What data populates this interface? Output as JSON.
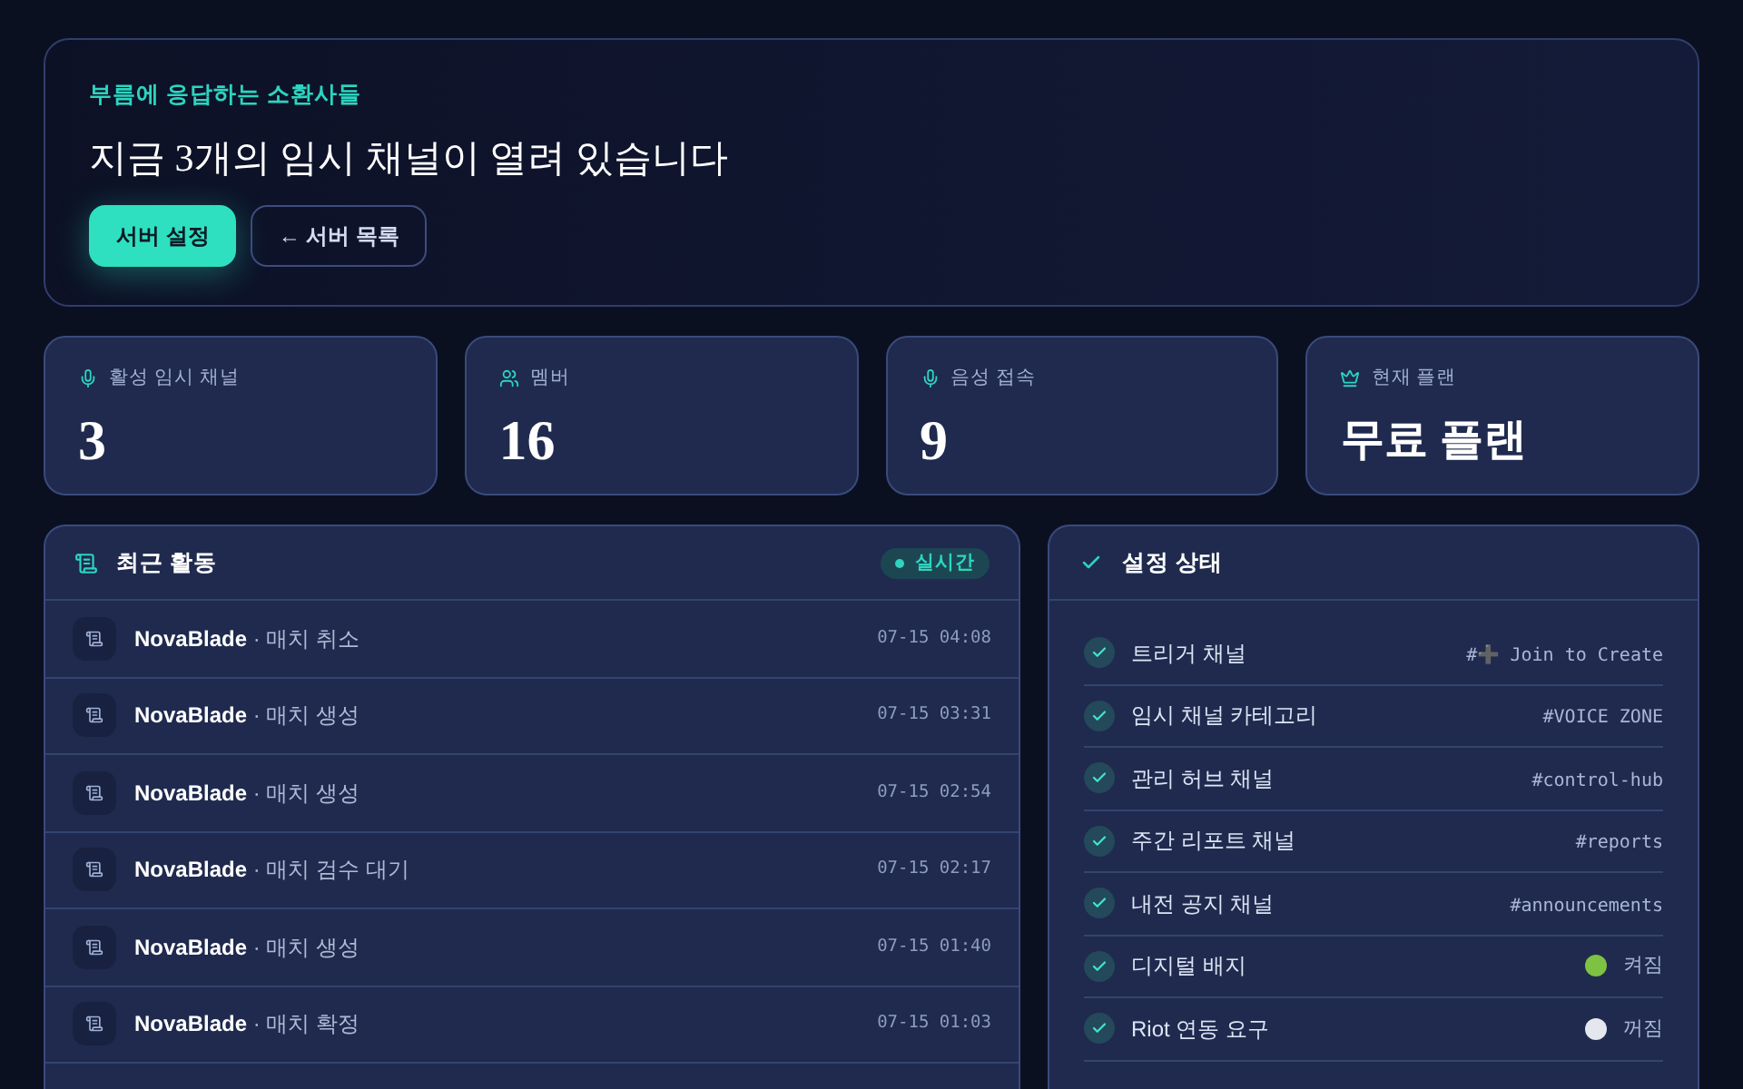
{
  "hero": {
    "eyebrow": "부름에 응답하는 소환사들",
    "title": "지금 3개의 임시 채널이 열려 있습니다",
    "buttons": [
      {
        "label": "서버 설정",
        "kind": "primary"
      },
      {
        "label": "← 서버 목록",
        "kind": "secondary"
      }
    ]
  },
  "stats": [
    {
      "label": "활성 임시 채널",
      "value": "3",
      "kind": "number"
    },
    {
      "label": "멤버",
      "value": "16",
      "kind": "number"
    },
    {
      "label": "음성 접속",
      "value": "9",
      "kind": "number"
    },
    {
      "label": "현재 플랜",
      "value": "무료 플랜",
      "kind": "text"
    }
  ],
  "activity": {
    "title": "최근 활동",
    "badge": "실시간",
    "rows": [
      {
        "text": "**NovaBlade** · 매치 취소",
        "time": "07-15 04:08"
      },
      {
        "text": "**NovaBlade** · 매치 생성",
        "time": "07-15 03:31"
      },
      {
        "text": "**NovaBlade** · 매치 생성",
        "time": "07-15 02:54"
      },
      {
        "text": "**NovaBlade** · 매치 검수 대기",
        "time": "07-15 02:17"
      },
      {
        "text": "**NovaBlade** · 매치 생성",
        "time": "07-15 01:40"
      },
      {
        "text": "**NovaBlade** · 매치 확정",
        "time": "07-15 01:03"
      }
    ]
  },
  "settings": {
    "title": "설정 상태",
    "rows": [
      {
        "label": "트리거 채널",
        "kind": "channel",
        "value": "#➕ Join to Create",
        "done": true
      },
      {
        "label": "임시 채널 카테고리",
        "kind": "channel",
        "value": "#VOICE ZONE",
        "done": true
      },
      {
        "label": "관리 허브 채널",
        "kind": "channel",
        "value": "#control-hub",
        "done": true
      },
      {
        "label": "주간 리포트 채널",
        "kind": "channel",
        "value": "#reports",
        "done": true
      },
      {
        "label": "내전 공지 채널",
        "kind": "channel",
        "value": "#announcements",
        "done": true
      },
      {
        "label": "디지털 배지",
        "kind": "toggle",
        "on": true,
        "value": "켜짐",
        "done": true
      },
      {
        "label": "Riot 연동 요구",
        "kind": "toggle",
        "on": false,
        "value": "꺼짐",
        "done": true
      }
    ]
  }
}
